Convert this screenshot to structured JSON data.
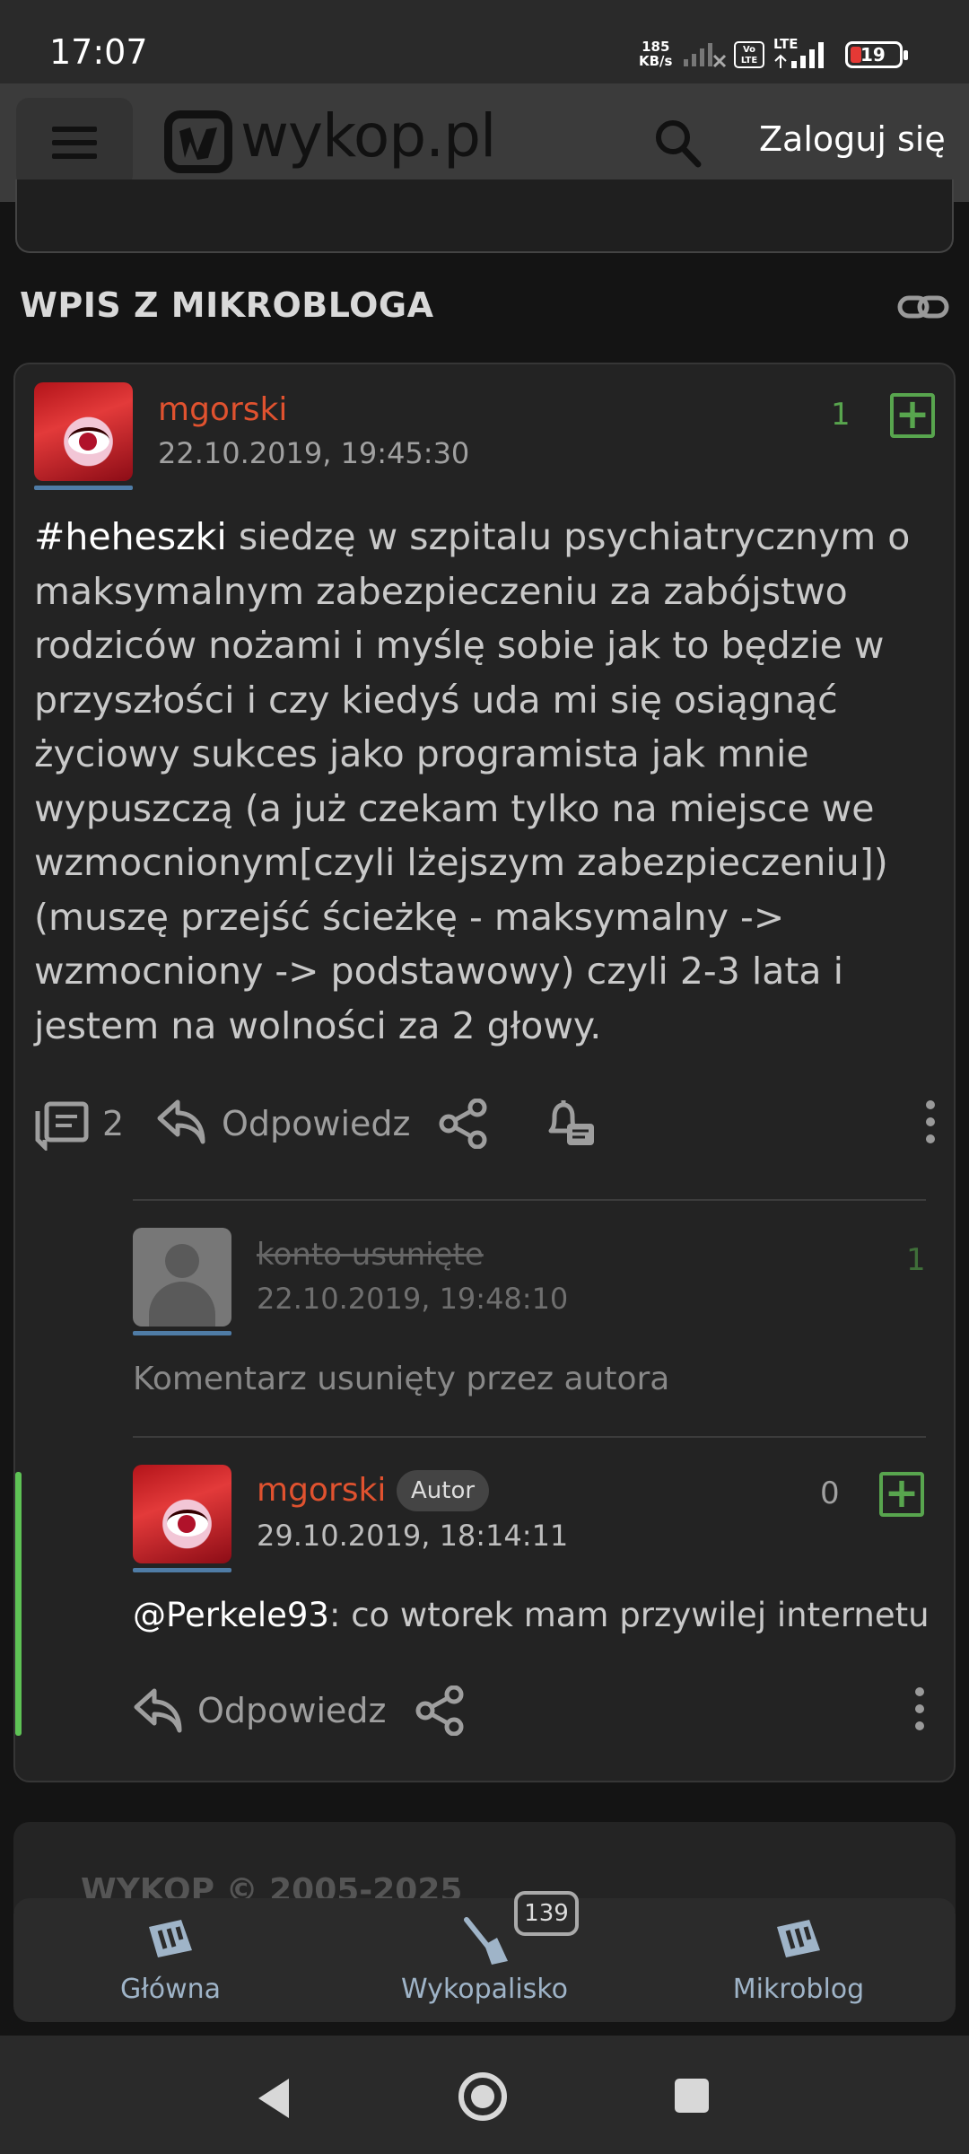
{
  "status_bar": {
    "time": "17:07",
    "net_speed": "185",
    "net_speed_unit": "KB/s",
    "volte": "Vo LTE",
    "lte": "LTE",
    "battery": "19"
  },
  "header": {
    "logo_text": "wykop.pl",
    "login_label": "Zaloguj się"
  },
  "section": {
    "title": "WPIS Z MIKROBLOGA"
  },
  "entry": {
    "author": "mgorski",
    "date": "22.10.2019, 19:45:30",
    "votes": "1",
    "tag": "#heheszki",
    "body_lines": [
      " siedzę w szpitalu psychiatrycznym o",
      "maksymalnym zabezpieczeniu za zabójstwo",
      "rodziców nożami i myślę sobie jak to będzie w",
      "przyszłości i czy kiedyś uda mi się osiągnąć",
      "życiowy sukces jako programista jak mnie",
      "wypuszczą (a już czekam tylko na miejsce we",
      "wzmocnionym[czyli lżejszym zabezpieczeniu])",
      "(muszę przejść ścieżkę - maksymalny ->",
      "wzmocniony -> podstawowy) czyli 2-3 lata i",
      "jestem na wolności za 2 głowy."
    ],
    "comment_count": "2",
    "reply_label": "Odpowiedz"
  },
  "comments": [
    {
      "author": "konto usunięte",
      "date": "22.10.2019, 19:48:10",
      "votes": "1",
      "text": "Komentarz usunięty przez autora"
    },
    {
      "author": "mgorski",
      "badge": "Autor",
      "date": "29.10.2019, 18:14:11",
      "votes": "0",
      "mention": "@Perkele93",
      "text": ": co wtorek mam przywilej internetu",
      "reply_label": "Odpowiedz"
    }
  ],
  "footer": {
    "copyright": "WYKOP © 2005-2025"
  },
  "bottom_nav": {
    "items": [
      {
        "label": "Główna"
      },
      {
        "label": "Wykopalisko",
        "badge": "139"
      },
      {
        "label": "Mikroblog"
      }
    ]
  },
  "colors": {
    "username": "#e0522f",
    "vote_green": "#58a54e",
    "accent_bar": "#5ec255",
    "nav_label": "#9fb4c8"
  }
}
